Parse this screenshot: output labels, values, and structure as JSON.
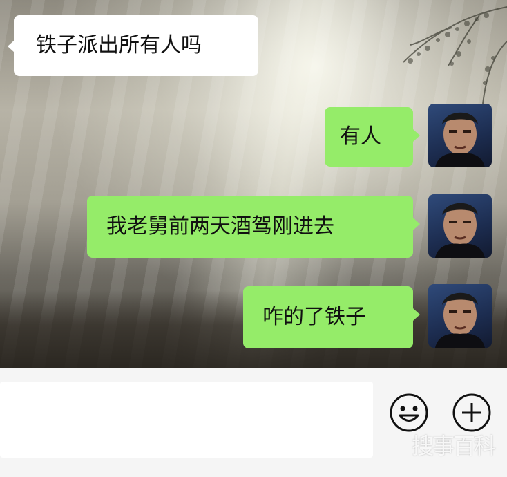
{
  "messages": [
    {
      "side": "left",
      "text": "铁子派出所有人吗"
    },
    {
      "side": "right",
      "text": "有人"
    },
    {
      "side": "right",
      "text": "我老舅前两天酒驾刚进去"
    },
    {
      "side": "right",
      "text": "咋的了铁子"
    }
  ],
  "input": {
    "value": "",
    "emoji_icon": "smiley-face-icon",
    "add_icon": "plus-circle-icon"
  },
  "watermark": "搜事百科",
  "colors": {
    "incoming_bubble": "#ffffff",
    "outgoing_bubble": "#95ec69",
    "input_bar": "#f5f5f5"
  }
}
